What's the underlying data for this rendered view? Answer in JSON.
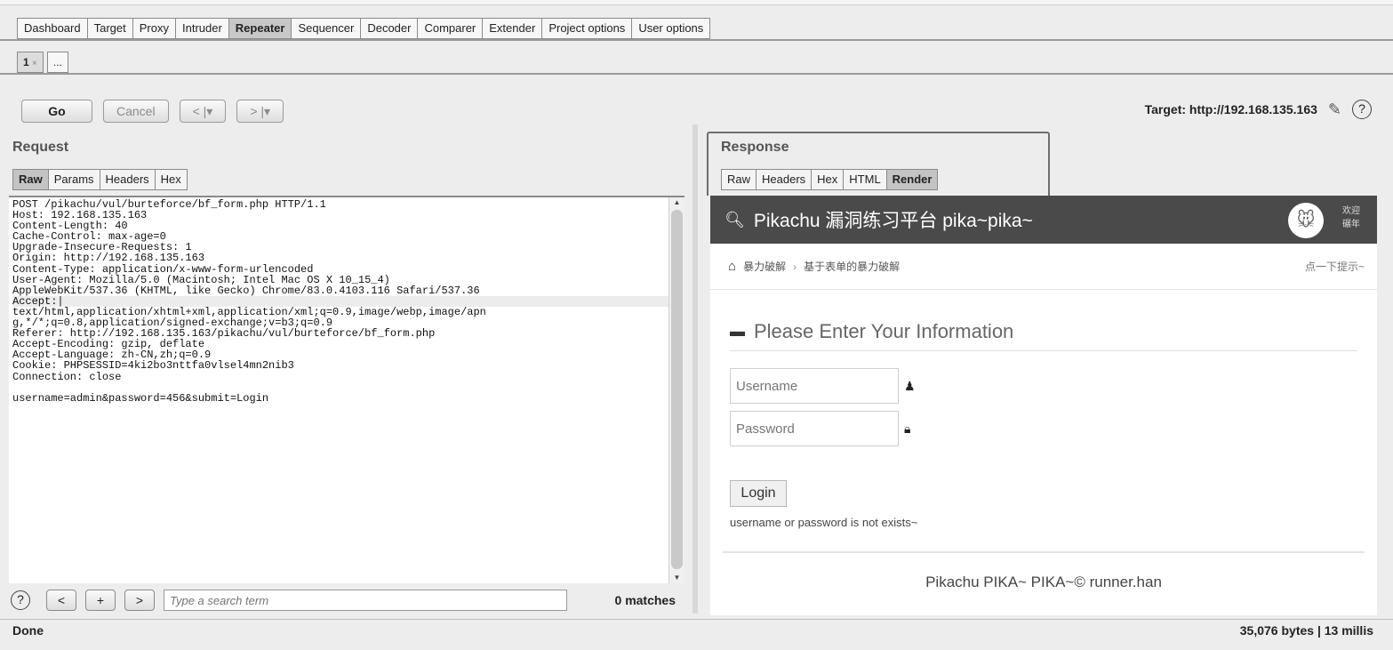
{
  "main_tabs": [
    "Dashboard",
    "Target",
    "Proxy",
    "Intruder",
    "Repeater",
    "Sequencer",
    "Decoder",
    "Comparer",
    "Extender",
    "Project options",
    "User options"
  ],
  "active_main_tab": "Repeater",
  "repeater_tabs": {
    "tab1": "1",
    "close": "×",
    "new": "..."
  },
  "toolbar": {
    "go": "Go",
    "cancel": "Cancel",
    "back": "< |▾",
    "forward": "> |▾"
  },
  "target": {
    "label": "Target: http://192.168.135.163",
    "help": "?"
  },
  "request": {
    "title": "Request",
    "tabs": [
      "Raw",
      "Params",
      "Headers",
      "Hex"
    ],
    "lines_before": "POST /pikachu/vul/burteforce/bf_form.php HTTP/1.1\nHost: 192.168.135.163\nContent-Length: 40\nCache-Control: max-age=0\nUpgrade-Insecure-Requests: 1\nOrigin: http://192.168.135.163\nContent-Type: application/x-www-form-urlencoded\nUser-Agent: Mozilla/5.0 (Macintosh; Intel Mac OS X 10_15_4)\nAppleWebKit/537.36 (KHTML, like Gecko) Chrome/83.0.4103.116 Safari/537.36",
    "highlight_line": "Accept:|",
    "lines_after": "text/html,application/xhtml+xml,application/xml;q=0.9,image/webp,image/apn\ng,*/*;q=0.8,application/signed-exchange;v=b3;q=0.9\nReferer: http://192.168.135.163/pikachu/vul/burteforce/bf_form.php\nAccept-Encoding: gzip, deflate\nAccept-Language: zh-CN,zh;q=0.9\nCookie: PHPSESSID=4ki2bo3nttfa0vlsel4mn2nib3\nConnection: close\n\nusername=admin&password=456&submit=Login"
  },
  "search": {
    "help": "?",
    "prev": "<",
    "add": "+",
    "next": ">",
    "placeholder": "Type a search term",
    "matches": "0 matches"
  },
  "response": {
    "title": "Response",
    "tabs": [
      "Raw",
      "Headers",
      "Hex",
      "HTML",
      "Render"
    ],
    "active_tab": "Render"
  },
  "render": {
    "site_title": "Pikachu 漏洞练习平台 pika~pika~",
    "welcome": "欢迎\n碾年",
    "breadcrumb_1": "暴力破解",
    "breadcrumb_sep": "›",
    "breadcrumb_2": "基于表单的暴力破解",
    "hint": "点一下提示~",
    "form_title": "Please Enter Your Information",
    "username_placeholder": "Username",
    "password_placeholder": "Password",
    "login": "Login",
    "message": "username or password is not exists~",
    "footer": "Pikachu PIKA~ PIKA~© runner.han"
  },
  "status": {
    "left": "Done",
    "right": "35,076 bytes | 13 millis"
  }
}
